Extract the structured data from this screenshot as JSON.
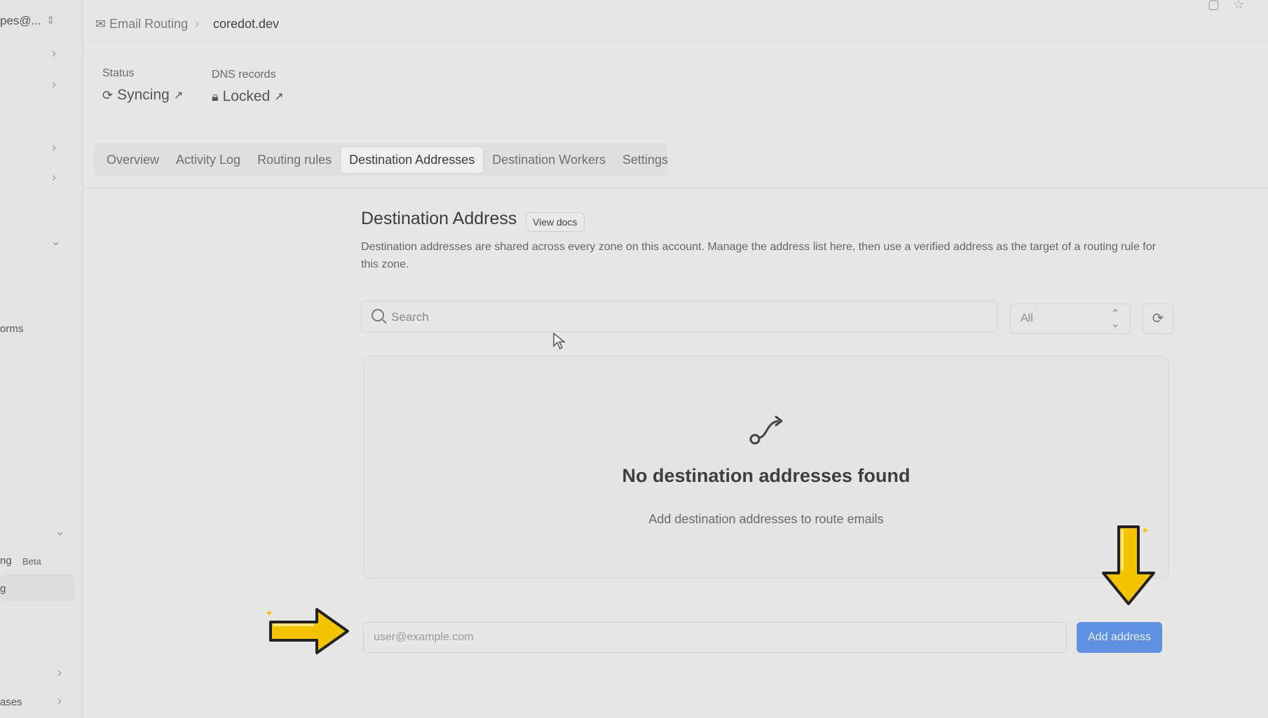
{
  "sidebar": {
    "account": "pes@...",
    "items": [
      {
        "label": "orms"
      },
      {
        "label": "ng",
        "badge": "Beta"
      },
      {
        "label": "g"
      },
      {
        "label": "ases"
      }
    ]
  },
  "breadcrumb": {
    "home": "Email Routing",
    "current": "coredot.dev"
  },
  "status": {
    "status_label": "Status",
    "status_value": "Syncing",
    "dns_label": "DNS records",
    "dns_value": "Locked"
  },
  "tabs": [
    {
      "label": "Overview"
    },
    {
      "label": "Activity Log"
    },
    {
      "label": "Routing rules"
    },
    {
      "label": "Destination Addresses",
      "active": true
    },
    {
      "label": "Destination Workers"
    },
    {
      "label": "Settings"
    }
  ],
  "section": {
    "title": "Destination Address",
    "docs_button": "View docs",
    "description": "Destination addresses are shared across every zone on this account. Manage the address list here, then use a verified address as the target of a routing rule for this zone."
  },
  "search": {
    "placeholder": "Search"
  },
  "filter": {
    "value": "All"
  },
  "empty_state": {
    "title": "No destination addresses found",
    "subtitle": "Add destination addresses to route emails"
  },
  "add_form": {
    "placeholder": "user@example.com",
    "button": "Add address"
  },
  "colors": {
    "primary_button": "#5e92e0",
    "annotation_arrow": "#f5c400"
  },
  "icons": {
    "breadcrumb": "mail-icon",
    "status": "sync-icon",
    "dns": "lock-icon",
    "external": "external-link-icon",
    "search": "search-icon",
    "refresh": "refresh-icon",
    "empty": "route-icon"
  }
}
